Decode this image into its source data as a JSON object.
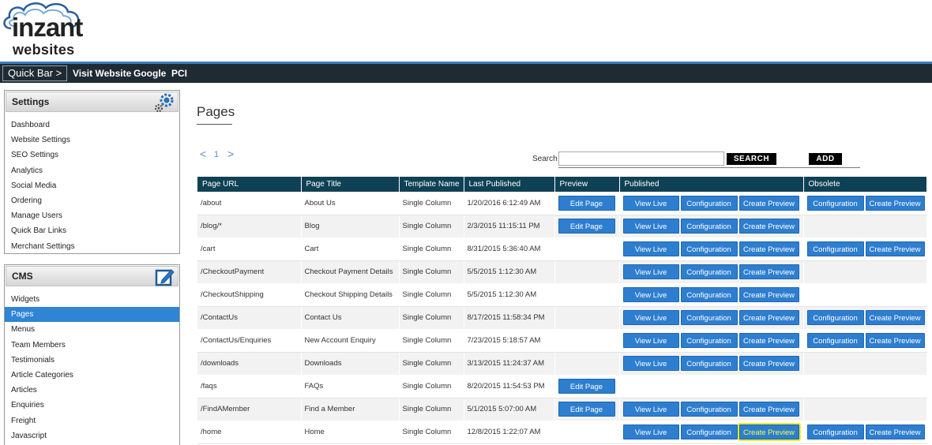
{
  "logo": {
    "brand": "inzant",
    "sub": "websites"
  },
  "quickbar": {
    "label": "Quick Bar >",
    "links": [
      "Visit Website",
      "Google",
      "PCI"
    ]
  },
  "sidebar": {
    "settings": {
      "title": "Settings",
      "icon": "gears-icon",
      "items": [
        "Dashboard",
        "Website Settings",
        "SEO Settings",
        "Analytics",
        "Social Media",
        "Ordering",
        "Manage Users",
        "Quick Bar Links",
        "Merchant Settings"
      ]
    },
    "cms": {
      "title": "CMS",
      "icon": "edit-icon",
      "active_item": "Pages",
      "items": [
        "Widgets",
        "Pages",
        "Menus",
        "Team Members",
        "Testimonials",
        "Article Categories",
        "Articles",
        "Enquiries",
        "Freight",
        "Javascript"
      ]
    }
  },
  "main": {
    "title": "Pages",
    "pager": {
      "prev": "<",
      "page": "1",
      "next": ">"
    },
    "search": {
      "label": "Search",
      "value": "",
      "button": "SEARCH"
    },
    "add_button": "ADD",
    "table": {
      "headers": {
        "url": "Page URL",
        "title": "Page Title",
        "template": "Template Name",
        "published_date": "Last Published",
        "preview": "Preview",
        "published": "Published",
        "obsolete": "Obsolete"
      },
      "button_labels": {
        "edit": "Edit Page",
        "view": "View Live",
        "config": "Configuration",
        "create_preview": "Create Preview"
      },
      "rows": [
        {
          "url": "/about",
          "title": "About Us",
          "template": "Single Column",
          "published": "1/20/2016 6:12:49 AM",
          "edit": true,
          "pub": true,
          "obs": true
        },
        {
          "url": "/blog/*",
          "title": "Blog",
          "template": "Single Column",
          "published": "2/3/2015 11:15:11 PM",
          "edit": true,
          "pub": true,
          "obs": false
        },
        {
          "url": "/cart",
          "title": "Cart",
          "template": "Single Column",
          "published": "8/31/2015 5:36:40 AM",
          "edit": false,
          "pub": true,
          "obs": true
        },
        {
          "url": "/CheckoutPayment",
          "title": "Checkout Payment Details",
          "template": "Single Column",
          "published": "5/5/2015 1:12:30 AM",
          "edit": false,
          "pub": true,
          "obs": false
        },
        {
          "url": "/CheckoutShipping",
          "title": "Checkout Shipping Details",
          "template": "Single Column",
          "published": "5/5/2015 1:12:30 AM",
          "edit": false,
          "pub": true,
          "obs": false
        },
        {
          "url": "/ContactUs",
          "title": "Contact Us",
          "template": "Single Column",
          "published": "8/17/2015 11:58:34 PM",
          "edit": false,
          "pub": true,
          "obs": true
        },
        {
          "url": "/ContactUs/Enquiries",
          "title": "New Account Enquiry",
          "template": "Single Column",
          "published": "7/23/2015 5:18:57 AM",
          "edit": false,
          "pub": true,
          "obs": true
        },
        {
          "url": "/downloads",
          "title": "Downloads",
          "template": "Single Column",
          "published": "3/13/2015 11:24:37 AM",
          "edit": false,
          "pub": true,
          "obs": false
        },
        {
          "url": "/faqs",
          "title": "FAQs",
          "template": "Single Column",
          "published": "8/20/2015 11:54:53 PM",
          "edit": true,
          "pub": false,
          "obs": false
        },
        {
          "url": "/FindAMember",
          "title": "Find a Member",
          "template": "Single Column",
          "published": "5/1/2015 5:07:00 AM",
          "edit": true,
          "pub": true,
          "obs": false
        },
        {
          "url": "/home",
          "title": "Home",
          "template": "Single Column",
          "published": "12/8/2015 1:22:07 AM",
          "edit": false,
          "pub": true,
          "obs": true,
          "highlight_preview": true
        }
      ]
    }
  },
  "colors": {
    "header_bar": "#1f2b33",
    "accent_line": "#3b7dc4",
    "table_header": "#0f4155",
    "button": "#2e7ed0",
    "active_item": "#2f84d4",
    "highlight": "#e9f020"
  }
}
